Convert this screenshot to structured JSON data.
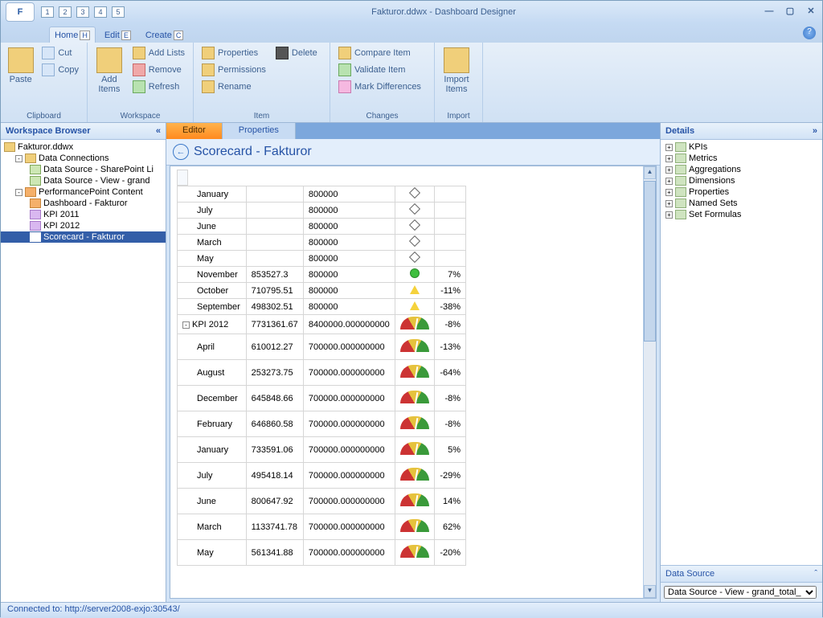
{
  "window": {
    "title": "Fakturor.ddwx - Dashboard Designer"
  },
  "qat": [
    "1",
    "2",
    "3",
    "4",
    "5"
  ],
  "appmenu_letter": "F",
  "ribbonTabs": [
    {
      "label": "Home",
      "key": "H",
      "active": true
    },
    {
      "label": "Edit",
      "key": "E",
      "active": false
    },
    {
      "label": "Create",
      "key": "C",
      "active": false
    }
  ],
  "ribbon": {
    "clipboard": {
      "label": "Clipboard",
      "paste": "Paste",
      "cut": "Cut",
      "copy": "Copy"
    },
    "workspace": {
      "label": "Workspace",
      "additems": "Add\nItems",
      "addlists": "Add Lists",
      "remove": "Remove",
      "refresh": "Refresh"
    },
    "item": {
      "label": "Item",
      "properties": "Properties",
      "permissions": "Permissions",
      "rename": "Rename",
      "delete": "Delete"
    },
    "changes": {
      "label": "Changes",
      "compare": "Compare Item",
      "validate": "Validate Item",
      "mark": "Mark Differences"
    },
    "import": {
      "label": "Import",
      "importitems": "Import\nItems"
    }
  },
  "workspaceBrowser": {
    "title": "Workspace Browser",
    "root": "Fakturor.ddwx",
    "dataConnections": "Data Connections",
    "ds1": "Data Source - SharePoint Li",
    "ds2": "Data Source - View - grand",
    "ppContent": "PerformancePoint Content",
    "dash": "Dashboard - Fakturor",
    "kpi2011": "KPI 2011",
    "kpi2012": "KPI 2012",
    "scorecard": "Scorecard - Fakturor"
  },
  "centerTabs": {
    "editor": "Editor",
    "properties": "Properties"
  },
  "scorecardTitle": "Scorecard - Fakturor",
  "rows": [
    {
      "name": "January",
      "val": "",
      "tgt": "800000",
      "ind": "diamond",
      "pct": ""
    },
    {
      "name": "July",
      "val": "",
      "tgt": "800000",
      "ind": "diamond",
      "pct": ""
    },
    {
      "name": "June",
      "val": "",
      "tgt": "800000",
      "ind": "diamond",
      "pct": ""
    },
    {
      "name": "March",
      "val": "",
      "tgt": "800000",
      "ind": "diamond",
      "pct": ""
    },
    {
      "name": "May",
      "val": "",
      "tgt": "800000",
      "ind": "diamond",
      "pct": ""
    },
    {
      "name": "November",
      "val": "853527.3",
      "tgt": "800000",
      "ind": "green",
      "pct": "7%"
    },
    {
      "name": "October",
      "val": "710795.51",
      "tgt": "800000",
      "ind": "yellow",
      "pct": "-11%"
    },
    {
      "name": "September",
      "val": "498302.51",
      "tgt": "800000",
      "ind": "yellow",
      "pct": "-38%"
    }
  ],
  "kpi2012row": {
    "name": "KPI 2012",
    "val": "7731361.67",
    "tgt": "8400000.000000000",
    "pct": "-8%"
  },
  "rows2": [
    {
      "name": "April",
      "val": "610012.27",
      "tgt": "700000.000000000",
      "pct": "-13%"
    },
    {
      "name": "August",
      "val": "253273.75",
      "tgt": "700000.000000000",
      "pct": "-64%"
    },
    {
      "name": "December",
      "val": "645848.66",
      "tgt": "700000.000000000",
      "pct": "-8%"
    },
    {
      "name": "February",
      "val": "646860.58",
      "tgt": "700000.000000000",
      "pct": "-8%"
    },
    {
      "name": "January",
      "val": "733591.06",
      "tgt": "700000.000000000",
      "pct": "5%"
    },
    {
      "name": "July",
      "val": "495418.14",
      "tgt": "700000.000000000",
      "pct": "-29%"
    },
    {
      "name": "June",
      "val": "800647.92",
      "tgt": "700000.000000000",
      "pct": "14%"
    },
    {
      "name": "March",
      "val": "1133741.78",
      "tgt": "700000.000000000",
      "pct": "62%"
    },
    {
      "name": "May",
      "val": "561341.88",
      "tgt": "700000.000000000",
      "pct": "-20%"
    }
  ],
  "details": {
    "title": "Details",
    "nodes": [
      "KPIs",
      "Metrics",
      "Aggregations",
      "Dimensions",
      "Properties",
      "Named Sets",
      "Set Formulas"
    ],
    "dataSourceLabel": "Data Source",
    "dataSourceValue": "Data Source - View - grand_total_"
  },
  "status": "Connected to: http://server2008-exjo:30543/"
}
